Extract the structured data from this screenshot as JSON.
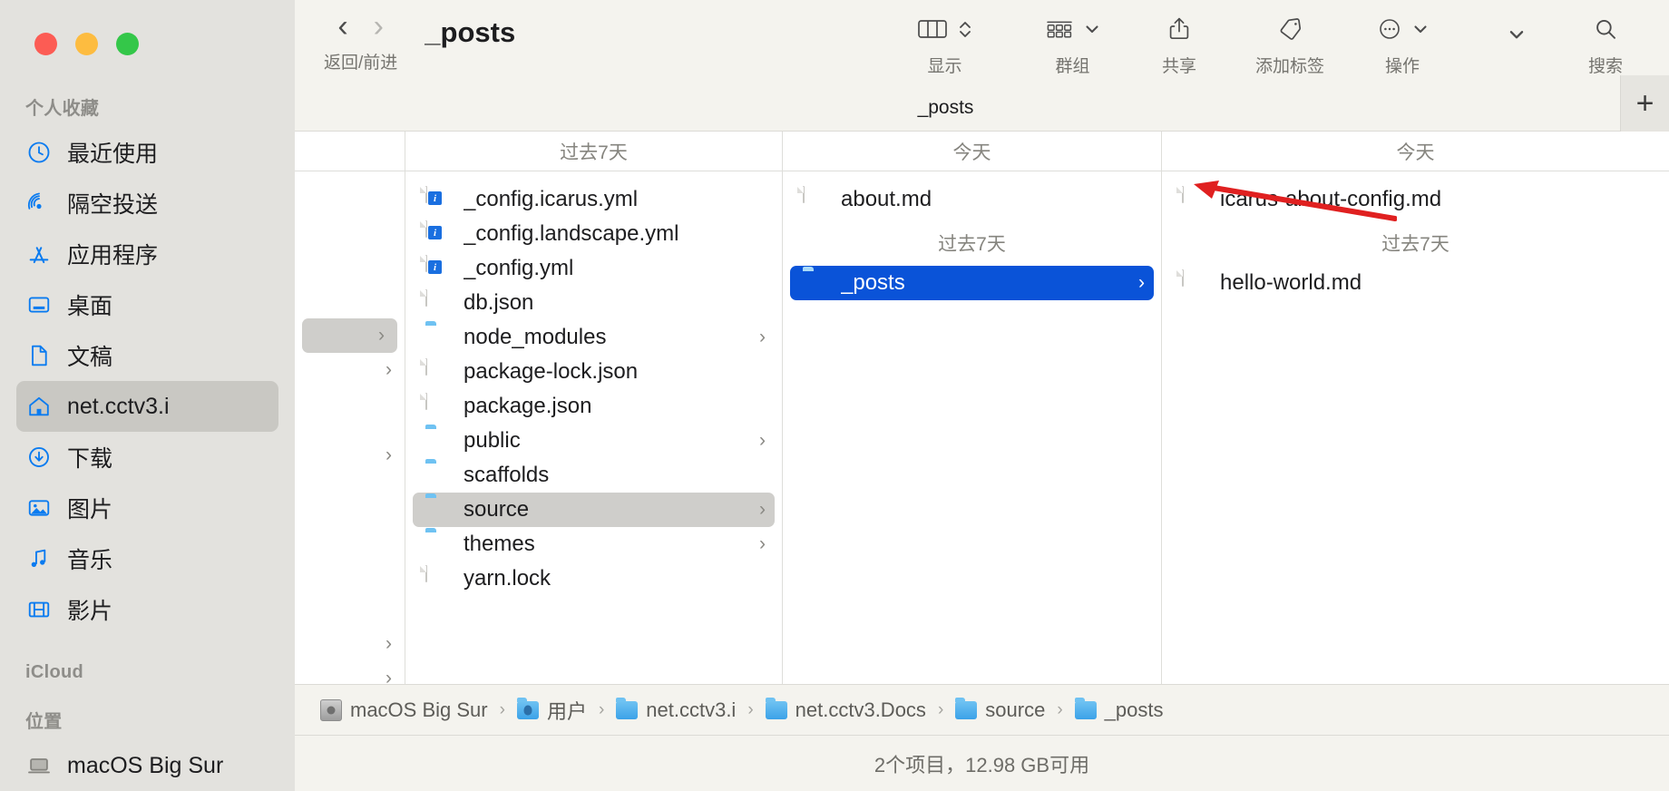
{
  "window": {
    "title": "_posts",
    "traffic_lights": [
      "close",
      "minimize",
      "maximize"
    ]
  },
  "sidebar": {
    "sections": [
      {
        "title": "个人收藏",
        "items": [
          {
            "label": "最近使用",
            "icon": "clock-icon",
            "selected": false
          },
          {
            "label": "隔空投送",
            "icon": "airdrop-icon",
            "selected": false
          },
          {
            "label": "应用程序",
            "icon": "applications-icon",
            "selected": false
          },
          {
            "label": "桌面",
            "icon": "desktop-icon",
            "selected": false
          },
          {
            "label": "文稿",
            "icon": "documents-icon",
            "selected": false
          },
          {
            "label": "net.cctv3.i",
            "icon": "home-icon",
            "selected": true
          },
          {
            "label": "下载",
            "icon": "downloads-icon",
            "selected": false
          },
          {
            "label": "图片",
            "icon": "pictures-icon",
            "selected": false
          },
          {
            "label": "音乐",
            "icon": "music-icon",
            "selected": false
          },
          {
            "label": "影片",
            "icon": "movies-icon",
            "selected": false
          }
        ]
      },
      {
        "title": "iCloud",
        "items": []
      },
      {
        "title": "位置",
        "items": [
          {
            "label": "macOS Big Sur",
            "icon": "computer-icon",
            "selected": false
          }
        ]
      }
    ]
  },
  "toolbar": {
    "nav_label": "返回/前进",
    "back_glyph": "‹",
    "forward_glyph": "›",
    "title": "_posts",
    "buttons": [
      {
        "label": "显示",
        "icon": "column-view-icon",
        "accessory": "stepper"
      },
      {
        "label": "群组",
        "icon": "group-by-icon",
        "accessory": "chevron-down"
      },
      {
        "label": "共享",
        "icon": "share-icon",
        "accessory": "none"
      },
      {
        "label": "添加标签",
        "icon": "tag-icon",
        "accessory": "none"
      },
      {
        "label": "操作",
        "icon": "more-actions-icon",
        "accessory": "chevron-down"
      },
      {
        "label": "",
        "icon": "overflow-chevron-icon",
        "accessory": "none"
      },
      {
        "label": "搜索",
        "icon": "search-icon",
        "accessory": "none"
      }
    ]
  },
  "tabbar": {
    "active_tab": "_posts",
    "add_tab_glyph": "+"
  },
  "columns": [
    {
      "header": "",
      "groups": [],
      "ghost_rows": [
        {
          "arrow": "›",
          "selected": true
        },
        {
          "arrow": "›",
          "selected": false
        },
        {
          "arrow": "›",
          "selected": false
        },
        {
          "arrow": "›",
          "selected": false
        },
        {
          "arrow": "›",
          "selected": false
        }
      ]
    },
    {
      "header": "过去7天",
      "items": [
        {
          "name": "_config.icarus.yml",
          "icon": "yml-file-icon",
          "badge": "i",
          "arrow": "",
          "selected": false
        },
        {
          "name": "_config.landscape.yml",
          "icon": "yml-file-icon",
          "badge": "i",
          "arrow": "",
          "selected": false
        },
        {
          "name": "_config.yml",
          "icon": "yml-file-icon",
          "badge": "i",
          "arrow": "",
          "selected": false
        },
        {
          "name": "db.json",
          "icon": "json-file-icon",
          "badge": "",
          "arrow": "",
          "selected": false
        },
        {
          "name": "node_modules",
          "icon": "folder-icon",
          "badge": "",
          "arrow": "›",
          "selected": false
        },
        {
          "name": "package-lock.json",
          "icon": "json-file-icon",
          "badge": "",
          "arrow": "",
          "selected": false
        },
        {
          "name": "package.json",
          "icon": "json-file-icon",
          "badge": "",
          "arrow": "",
          "selected": false
        },
        {
          "name": "public",
          "icon": "folder-icon",
          "badge": "",
          "arrow": "›",
          "selected": false
        },
        {
          "name": "scaffolds",
          "icon": "folder-icon",
          "badge": "",
          "arrow": "",
          "selected": false
        },
        {
          "name": "source",
          "icon": "folder-icon",
          "badge": "",
          "arrow": "›",
          "selected": "gray"
        },
        {
          "name": "themes",
          "icon": "folder-icon",
          "badge": "",
          "arrow": "›",
          "selected": false
        },
        {
          "name": "yarn.lock",
          "icon": "text-file-icon",
          "badge": "",
          "arrow": "",
          "selected": false
        }
      ]
    },
    {
      "header": "今天",
      "items": [
        {
          "name": "about.md",
          "icon": "md-file-icon",
          "arrow": "",
          "selected": false
        }
      ],
      "group2_header": "过去7天",
      "group2_items": [
        {
          "name": "_posts",
          "icon": "folder-icon",
          "arrow": "›",
          "selected": "blue"
        }
      ]
    },
    {
      "header": "今天",
      "items": [
        {
          "name": "icarus-about-config.md",
          "icon": "md-file-icon",
          "arrow": "",
          "selected": false
        }
      ],
      "group2_header": "过去7天",
      "group2_items": [
        {
          "name": "hello-world.md",
          "icon": "md-file-icon",
          "arrow": "",
          "selected": false
        }
      ]
    }
  ],
  "pathbar": {
    "crumbs": [
      {
        "label": "macOS Big Sur",
        "icon": "disk-icon"
      },
      {
        "label": "用户",
        "icon": "user-folder-icon"
      },
      {
        "label": "net.cctv3.i",
        "icon": "folder-icon"
      },
      {
        "label": "net.cctv3.Docs",
        "icon": "folder-icon"
      },
      {
        "label": "source",
        "icon": "folder-icon"
      },
      {
        "label": "_posts",
        "icon": "folder-icon"
      }
    ],
    "separator": "›"
  },
  "statusbar": {
    "text": "2个项目，12.98 GB可用"
  },
  "annotation": {
    "type": "arrow",
    "color": "#e02020",
    "points_to": "about.md"
  },
  "colors": {
    "selection_blue": "#0a53d8",
    "selection_gray": "#cfcecb",
    "sidebar_bg": "#e3e2de",
    "toolbar_bg": "#f4f3ee",
    "accent_blue": "#0a7bf0",
    "annotation_red": "#e02020"
  }
}
